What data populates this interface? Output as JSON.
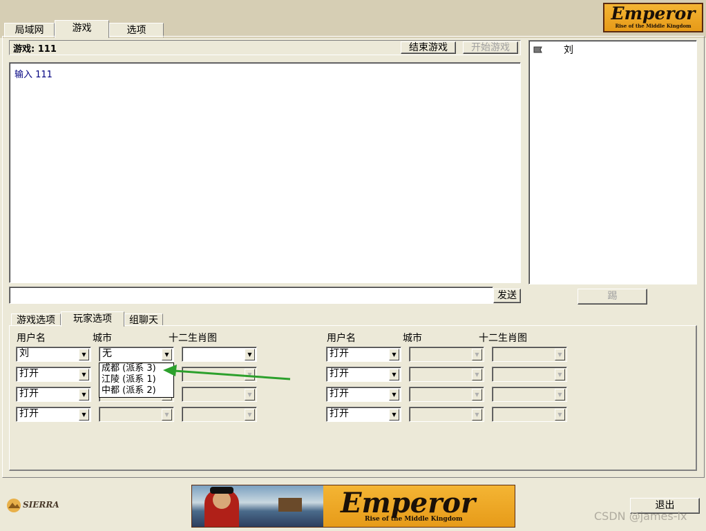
{
  "tabs": [
    "局域网",
    "游戏",
    "选项"
  ],
  "game": {
    "label": "游戏: 111",
    "end_button": "结束游戏",
    "start_button": "开始游戏"
  },
  "chat": {
    "lines": [
      "输入 111"
    ],
    "send_button": "发送",
    "input_value": ""
  },
  "players_list": [
    {
      "name": "刘"
    }
  ],
  "kick_button": "踢",
  "subtabs": [
    "游戏选项",
    "玩家选项",
    "组聊天"
  ],
  "headers": {
    "user": "用户名",
    "city": "城市",
    "zodiac": "十二生肖图"
  },
  "left_rows": [
    {
      "user": "刘",
      "city": "无",
      "zodiac": ""
    },
    {
      "user": "打开",
      "city": "",
      "zodiac": ""
    },
    {
      "user": "打开",
      "city": "",
      "zodiac": ""
    },
    {
      "user": "打开",
      "city": "",
      "zodiac": ""
    }
  ],
  "right_rows": [
    {
      "user": "打开",
      "city": "",
      "zodiac": ""
    },
    {
      "user": "打开",
      "city": "",
      "zodiac": ""
    },
    {
      "user": "打开",
      "city": "",
      "zodiac": ""
    },
    {
      "user": "打开",
      "city": "",
      "zodiac": ""
    }
  ],
  "city_dropdown": [
    "成都 (派系 3)",
    "江陵 (派系 1)",
    "中都 (派系 2)"
  ],
  "logo": {
    "main": "Emperor",
    "sub": "Rise of the Middle Kingdom"
  },
  "sierra": "SIERRA",
  "exit_button": "退出",
  "watermark": "CSDN @james-lx",
  "colors": {
    "chat_text": "#000080",
    "arrow": "#2ca02c",
    "logo_bg": "#f0a82a"
  }
}
